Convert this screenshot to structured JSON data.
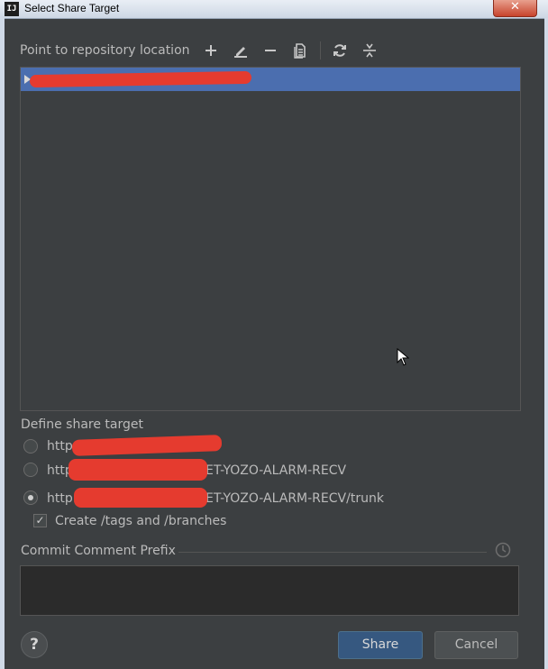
{
  "window": {
    "app_icon_text": "IJ",
    "title": "Select Share Target",
    "close_glyph": "✕"
  },
  "toolbar": {
    "label": "Point to repository location",
    "icons": [
      "add-icon",
      "edit-icon",
      "remove-icon",
      "browse-icon",
      "refresh-icon",
      "collapse-all-icon"
    ]
  },
  "tree": {
    "selected_row_label": "",
    "accent_color": "#4b6eaf"
  },
  "share_target": {
    "label": "Define share target",
    "options": [
      {
        "prefix": "http",
        "suffix": "",
        "checked": false
      },
      {
        "prefix": "http",
        "suffix": "ET-YOZO-ALARM-RECV",
        "checked": false
      },
      {
        "prefix": "http:",
        "suffix": "ET-YOZO-ALARM-RECV/trunk",
        "checked": true
      }
    ],
    "create_tags_label": "Create /tags and /branches",
    "create_tags_checked": true
  },
  "commit": {
    "label": "Commit Comment Prefix",
    "value": ""
  },
  "buttons": {
    "help": "?",
    "share": "Share",
    "cancel": "Cancel"
  },
  "colors": {
    "background": "#3c3f41",
    "primary_button": "#365880",
    "redaction": "#e53b2f"
  }
}
